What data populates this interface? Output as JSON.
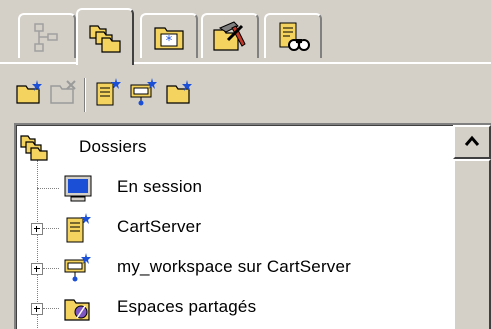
{
  "tabs": [
    {
      "icon": "tree-structure-icon",
      "active": false
    },
    {
      "icon": "folders-icon",
      "active": true
    },
    {
      "icon": "special-folder-icon",
      "active": false
    },
    {
      "icon": "hammer-tools-icon",
      "active": false
    },
    {
      "icon": "binoculars-search-icon",
      "active": false
    }
  ],
  "toolbar": [
    {
      "icon": "new-folder-icon",
      "enabled": true
    },
    {
      "icon": "delete-folder-icon",
      "enabled": false
    },
    {
      "icon": "new-server-icon",
      "enabled": true
    },
    {
      "icon": "new-workspace-icon",
      "enabled": true
    },
    {
      "icon": "new-share-folder-icon",
      "enabled": true
    }
  ],
  "tree": {
    "root": {
      "label": "Dossiers",
      "icon": "folders-icon"
    },
    "items": [
      {
        "label": "En session",
        "icon": "monitor-icon",
        "expandable": false
      },
      {
        "label": "CartServer",
        "icon": "server-icon",
        "expandable": true
      },
      {
        "label": "my_workspace sur CartServer",
        "icon": "workspace-icon",
        "expandable": true
      },
      {
        "label": "Espaces partagés",
        "icon": "shared-spaces-icon",
        "expandable": true
      }
    ]
  },
  "colors": {
    "face": "#d4d0c8",
    "folder_yellow": "#f4d35e",
    "monitor_blue": "#1a4fd6"
  }
}
